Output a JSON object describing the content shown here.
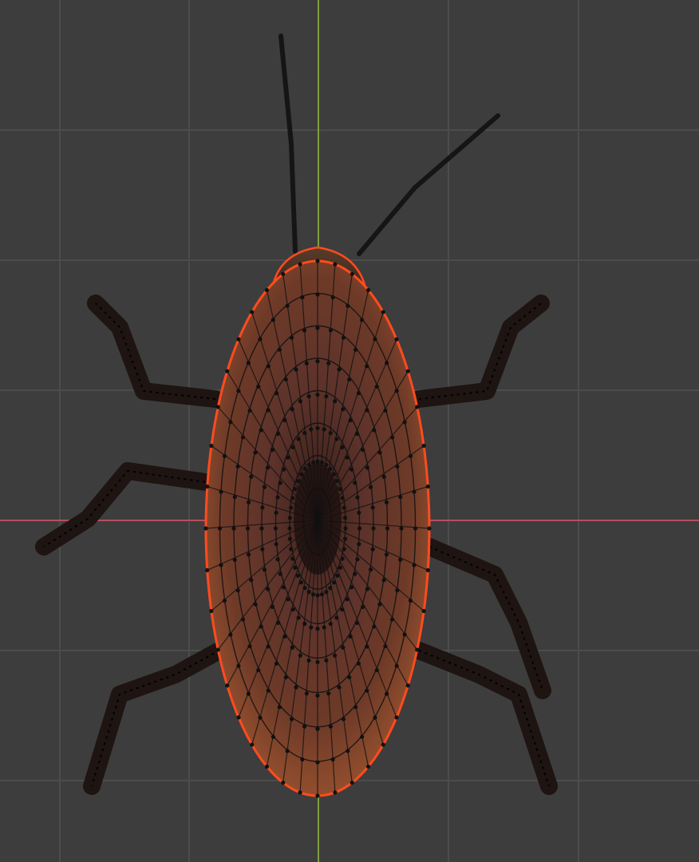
{
  "viewport": {
    "view": "top-orthographic",
    "mode": "edit",
    "colors": {
      "background": "#3d3d3d",
      "grid_line": "#4c4c4c",
      "x_axis": "#b4505f",
      "y_axis": "#7fa03c",
      "selection_edge": "#ff4b1e",
      "wire_vertex": "#111111"
    }
  },
  "object": {
    "name_hint": "cockroach-mesh",
    "colors": {
      "body_dark": "#2a1815",
      "body_mid": "#5c322a",
      "body_rim": "#9a5030",
      "leg": "#1e1412"
    }
  }
}
